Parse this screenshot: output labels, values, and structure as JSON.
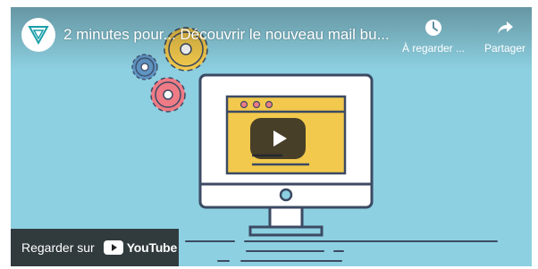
{
  "player": {
    "video_title": "2 minutes pour... Découvrir le nouveau mail bu...",
    "channel_logo_icon": "channel-logo-icon",
    "actions": [
      {
        "label": "À regarder ...",
        "icon": "clock-icon"
      },
      {
        "label": "Partager",
        "icon": "share-icon"
      }
    ],
    "play_button_icon": "play-icon",
    "watch_on": {
      "label": "Regarder sur",
      "brand": "YouTube"
    }
  },
  "colors": {
    "background": "#8dd0e1",
    "screen_yellow": "#f2c94c",
    "outline": "#3c4a63",
    "gear_yellow": "#f2c94c",
    "gear_blue": "#5f94c3",
    "gear_pink": "#ee7b85",
    "youtube_red": "#ff0000"
  }
}
